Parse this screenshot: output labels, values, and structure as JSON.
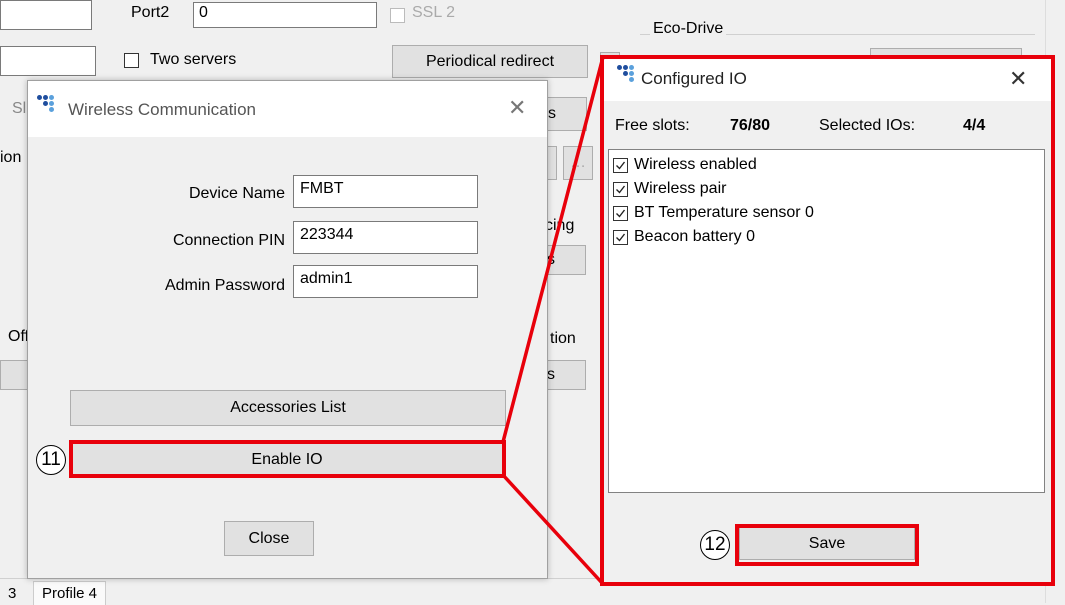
{
  "background": {
    "port_label": "Port2",
    "port_value": "0",
    "ssl_label": "SSL 2",
    "eco_drive_label": "Eco-Drive",
    "two_servers_label": "Two servers",
    "periodical_redirect_label": "Periodical redirect",
    "left_frag_1": "Sl",
    "left_frag_2": "ion",
    "left_frag_3": "Off",
    "right_frag_s": "s",
    "right_frag_cing": "cing",
    "right_frag_s2": "s",
    "right_frag_tion": "tion",
    "right_frag_s3": "s",
    "tab_frag": "3",
    "tab_profile4": "Profile 4"
  },
  "wireless_dialog": {
    "title": "Wireless Communication",
    "device_name_label": "Device Name",
    "device_name_value": "FMBT",
    "connection_pin_label": "Connection PIN",
    "connection_pin_value": "223344",
    "admin_password_label": "Admin Password",
    "admin_password_value": "admin1",
    "accessories_list_label": "Accessories List",
    "enable_io_label": "Enable IO",
    "close_label": "Close"
  },
  "configured_io_dialog": {
    "title": "Configured IO",
    "free_slots_label": "Free slots:",
    "free_slots_value": "76/80",
    "selected_ios_label": "Selected IOs:",
    "selected_ios_value": "4/4",
    "items": [
      {
        "label": "Wireless enabled",
        "checked": true
      },
      {
        "label": "Wireless pair",
        "checked": true
      },
      {
        "label": "BT Temperature sensor 0",
        "checked": true
      },
      {
        "label": "Beacon battery 0",
        "checked": true
      }
    ],
    "save_label": "Save"
  },
  "callouts": {
    "step_11": "11",
    "step_12": "12"
  },
  "colors": {
    "highlight": "#e8000b",
    "logo_blue": "#1f4e9e",
    "logo_light": "#5aa0dc"
  }
}
